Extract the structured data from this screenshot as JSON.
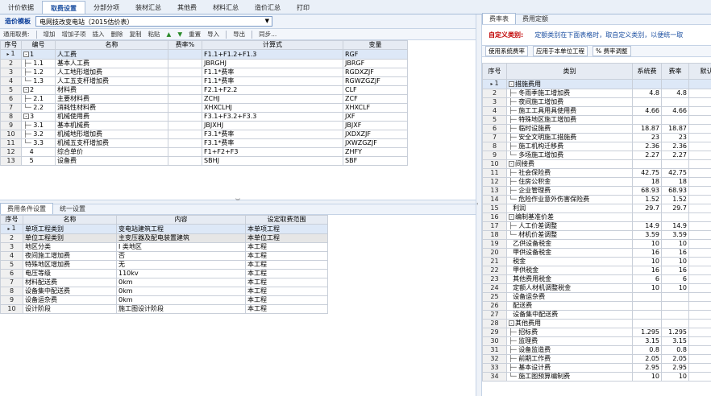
{
  "top_tabs": [
    "计价依据",
    "取费设置",
    "分部分项",
    "装材汇总",
    "其他费",
    "材料汇总",
    "造价汇总",
    "打印"
  ],
  "template": {
    "label": "造价模板",
    "value": "电网技改变电站（2015估价表）"
  },
  "toolbar": [
    "通用取费:",
    "增加",
    "增加子项",
    "插入",
    "删除",
    "复制",
    "粘贴",
    "重置",
    "导入",
    "导出",
    "同步..."
  ],
  "fee_table": {
    "headers": [
      "序号",
      "编号",
      "名称",
      "费率%",
      "计算式",
      "变量"
    ],
    "rows": [
      {
        "i": "1",
        "code": "1",
        "name": "人工费",
        "rate": "",
        "formula": "F1.1+F1.2+F1.3",
        "var": "RGF",
        "lvl": 0,
        "box": "-"
      },
      {
        "i": "2",
        "code": "1.1",
        "name": "基本人工费",
        "rate": "",
        "formula": "JBRGHJ",
        "var": "JBRGF",
        "lvl": 1
      },
      {
        "i": "3",
        "code": "1.2",
        "name": "人工地形增加费",
        "rate": "",
        "formula": "F1.1*费率",
        "var": "RGDXZJF",
        "lvl": 1
      },
      {
        "i": "4",
        "code": "1.3",
        "name": "人工五支杆增加费",
        "rate": "",
        "formula": "F1.1*费率",
        "var": "RGWZGZJF",
        "lvl": 1
      },
      {
        "i": "5",
        "code": "2",
        "name": "材料费",
        "rate": "",
        "formula": "F2.1+F2.2",
        "var": "CLF",
        "lvl": 0,
        "box": "-"
      },
      {
        "i": "6",
        "code": "2.1",
        "name": "主要材料费",
        "rate": "",
        "formula": "ZCHJ",
        "var": "ZCF",
        "lvl": 1
      },
      {
        "i": "7",
        "code": "2.2",
        "name": "消耗性材料费",
        "rate": "",
        "formula": "XHXCLHJ",
        "var": "XHXCLF",
        "lvl": 1
      },
      {
        "i": "8",
        "code": "3",
        "name": "机械使用费",
        "rate": "",
        "formula": "F3.1+F3.2+F3.3",
        "var": "JXF",
        "lvl": 0,
        "box": "-"
      },
      {
        "i": "9",
        "code": "3.1",
        "name": "基本机械费",
        "rate": "",
        "formula": "JBJXHJ",
        "var": "JBJXF",
        "lvl": 1
      },
      {
        "i": "10",
        "code": "3.2",
        "name": "机械地形增加费",
        "rate": "",
        "formula": "F3.1*费率",
        "var": "JXDXZJF",
        "lvl": 1
      },
      {
        "i": "11",
        "code": "3.3",
        "name": "机械五支杆增加费",
        "rate": "",
        "formula": "F3.1*费率",
        "var": "JXWZGZJF",
        "lvl": 1
      },
      {
        "i": "12",
        "code": "4",
        "name": "综合单价",
        "rate": "",
        "formula": "F1+F2+F3",
        "var": "ZHFY",
        "lvl": 0
      },
      {
        "i": "13",
        "code": "5",
        "name": "设备费",
        "rate": "",
        "formula": "SBHJ",
        "var": "SBF",
        "lvl": 0
      }
    ]
  },
  "sub_tabs": [
    "费用条件设置",
    "统一设置"
  ],
  "cond_table": {
    "headers": [
      "序号",
      "名称",
      "内容",
      "设定取费范围"
    ],
    "rows": [
      [
        "1",
        "单项工程类别",
        "变电站建筑工程",
        "本单项工程"
      ],
      [
        "2",
        "单位工程类别",
        "主变压器及配电装置建筑",
        "本单位工程"
      ],
      [
        "3",
        "地区分类",
        "I 类地区",
        "本工程"
      ],
      [
        "4",
        "夜间施工增加费",
        "否",
        "本工程"
      ],
      [
        "5",
        "特殊地区增加费",
        "无",
        "本工程"
      ],
      [
        "6",
        "电压等级",
        "110kv",
        "本工程"
      ],
      [
        "7",
        "材料配送费",
        "0km",
        "本工程"
      ],
      [
        "8",
        "设备集中配送费",
        "0km",
        "本工程"
      ],
      [
        "9",
        "设备运杂费",
        "0km",
        "本工程"
      ],
      [
        "10",
        "设计阶段",
        "施工图设计阶段",
        "本工程"
      ]
    ]
  },
  "right_tabs": [
    "费率表",
    "费用定额"
  ],
  "right_info": {
    "label": "自定义类别:",
    "text": "定额类别在下面表格时，取自定义类别，以便统一取"
  },
  "right_opts": [
    "使用系统费率",
    "应用于本单位工程",
    "% 费率调整"
  ],
  "rate_table": {
    "headers": [
      "序号",
      "类别",
      "系统费",
      "费率",
      "默认"
    ],
    "rows": [
      {
        "i": "1",
        "name": "措施费用",
        "sys": "",
        "rate": "",
        "lvl": 0,
        "box": "-"
      },
      {
        "i": "2",
        "name": "冬雨季施工增加费",
        "sys": "4.8",
        "rate": "4.8",
        "lvl": 1
      },
      {
        "i": "3",
        "name": "夜间施工增加费",
        "sys": "",
        "rate": "",
        "lvl": 1
      },
      {
        "i": "4",
        "name": "施工工具用具使用费",
        "sys": "4.66",
        "rate": "4.66",
        "lvl": 1
      },
      {
        "i": "5",
        "name": "特殊地区施工增加费",
        "sys": "",
        "rate": "",
        "lvl": 1
      },
      {
        "i": "6",
        "name": "临时设施费",
        "sys": "18.87",
        "rate": "18.87",
        "lvl": 1
      },
      {
        "i": "7",
        "name": "安全文明施工措施费",
        "sys": "23",
        "rate": "23",
        "lvl": 1
      },
      {
        "i": "8",
        "name": "施工机构迁移费",
        "sys": "2.36",
        "rate": "2.36",
        "lvl": 1
      },
      {
        "i": "9",
        "name": "多场施工增加费",
        "sys": "2.27",
        "rate": "2.27",
        "lvl": 1
      },
      {
        "i": "10",
        "name": "间接费",
        "sys": "",
        "rate": "",
        "lvl": 0,
        "box": "-"
      },
      {
        "i": "11",
        "name": "社会保险费",
        "sys": "42.75",
        "rate": "42.75",
        "lvl": 1
      },
      {
        "i": "12",
        "name": "住房公积金",
        "sys": "18",
        "rate": "18",
        "lvl": 1
      },
      {
        "i": "13",
        "name": "企业管理费",
        "sys": "68.93",
        "rate": "68.93",
        "lvl": 1
      },
      {
        "i": "14",
        "name": "危险作业意外伤害保险费",
        "sys": "1.52",
        "rate": "1.52",
        "lvl": 1
      },
      {
        "i": "15",
        "name": "利润",
        "sys": "29.7",
        "rate": "29.7",
        "lvl": 0
      },
      {
        "i": "16",
        "name": "编制基准价差",
        "sys": "",
        "rate": "",
        "lvl": 0,
        "box": "-"
      },
      {
        "i": "17",
        "name": "人工价差调整",
        "sys": "14.9",
        "rate": "14.9",
        "lvl": 1
      },
      {
        "i": "18",
        "name": "材机价差调整",
        "sys": "3.59",
        "rate": "3.59",
        "lvl": 1
      },
      {
        "i": "19",
        "name": "乙供设备税金",
        "sys": "10",
        "rate": "10",
        "lvl": 0
      },
      {
        "i": "20",
        "name": "甲供设备税金",
        "sys": "16",
        "rate": "16",
        "lvl": 0
      },
      {
        "i": "21",
        "name": "税金",
        "sys": "10",
        "rate": "10",
        "lvl": 0
      },
      {
        "i": "22",
        "name": "甲供税金",
        "sys": "16",
        "rate": "16",
        "lvl": 0
      },
      {
        "i": "23",
        "name": "其他费用税金",
        "sys": "6",
        "rate": "6",
        "lvl": 0
      },
      {
        "i": "24",
        "name": "定额人材机调整税金",
        "sys": "10",
        "rate": "10",
        "lvl": 0
      },
      {
        "i": "25",
        "name": "设备运杂费",
        "sys": "",
        "rate": "",
        "lvl": 0
      },
      {
        "i": "26",
        "name": "配送费",
        "sys": "",
        "rate": "",
        "lvl": 0
      },
      {
        "i": "27",
        "name": "设备集中配送费",
        "sys": "",
        "rate": "",
        "lvl": 0
      },
      {
        "i": "28",
        "name": "其他费用",
        "sys": "",
        "rate": "",
        "lvl": 0,
        "box": "-"
      },
      {
        "i": "29",
        "name": "招标费",
        "sys": "1.295",
        "rate": "1.295",
        "lvl": 1
      },
      {
        "i": "30",
        "name": "监理费",
        "sys": "3.15",
        "rate": "3.15",
        "lvl": 1
      },
      {
        "i": "31",
        "name": "设备监造费",
        "sys": "0.8",
        "rate": "0.8",
        "lvl": 1
      },
      {
        "i": "32",
        "name": "前期工作费",
        "sys": "2.05",
        "rate": "2.05",
        "lvl": 1
      },
      {
        "i": "33",
        "name": "基本设计费",
        "sys": "2.95",
        "rate": "2.95",
        "lvl": 1
      },
      {
        "i": "34",
        "name": "施工图预算编制费",
        "sys": "10",
        "rate": "10",
        "lvl": 1
      }
    ]
  }
}
